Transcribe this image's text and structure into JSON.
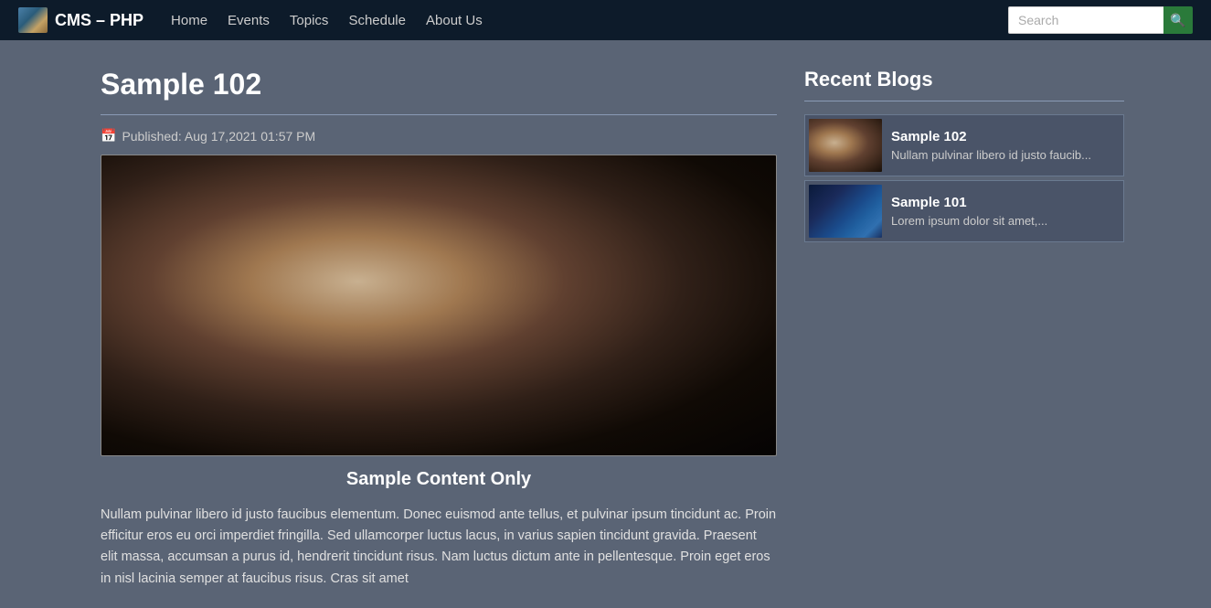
{
  "nav": {
    "brand": "CMS – PHP",
    "links": [
      "Home",
      "Events",
      "Topics",
      "Schedule",
      "About Us"
    ],
    "search_placeholder": "Search"
  },
  "main": {
    "title": "Sample 102",
    "published": "Published: Aug 17,2021 01:57 PM",
    "caption": "Sample Content Only",
    "body": "Nullam pulvinar libero id justo faucibus elementum. Donec euismod ante tellus, et pulvinar ipsum tincidunt ac. Proin efficitur eros eu orci imperdiet fringilla. Sed ullamcorper luctus lacus, in varius sapien tincidunt gravida. Praesent elit massa, accumsan a purus id, hendrerit tincidunt risus. Nam luctus dictum ante in pellentesque. Proin eget eros in nisl lacinia semper at faucibus risus. Cras sit amet"
  },
  "sidebar": {
    "title": "Recent Blogs",
    "blogs": [
      {
        "id": "102",
        "title": "Sample 102",
        "excerpt": "Nullam pulvinar libero id justo faucib..."
      },
      {
        "id": "101",
        "title": "Sample 101",
        "excerpt": "Lorem ipsum dolor sit amet,..."
      }
    ]
  }
}
